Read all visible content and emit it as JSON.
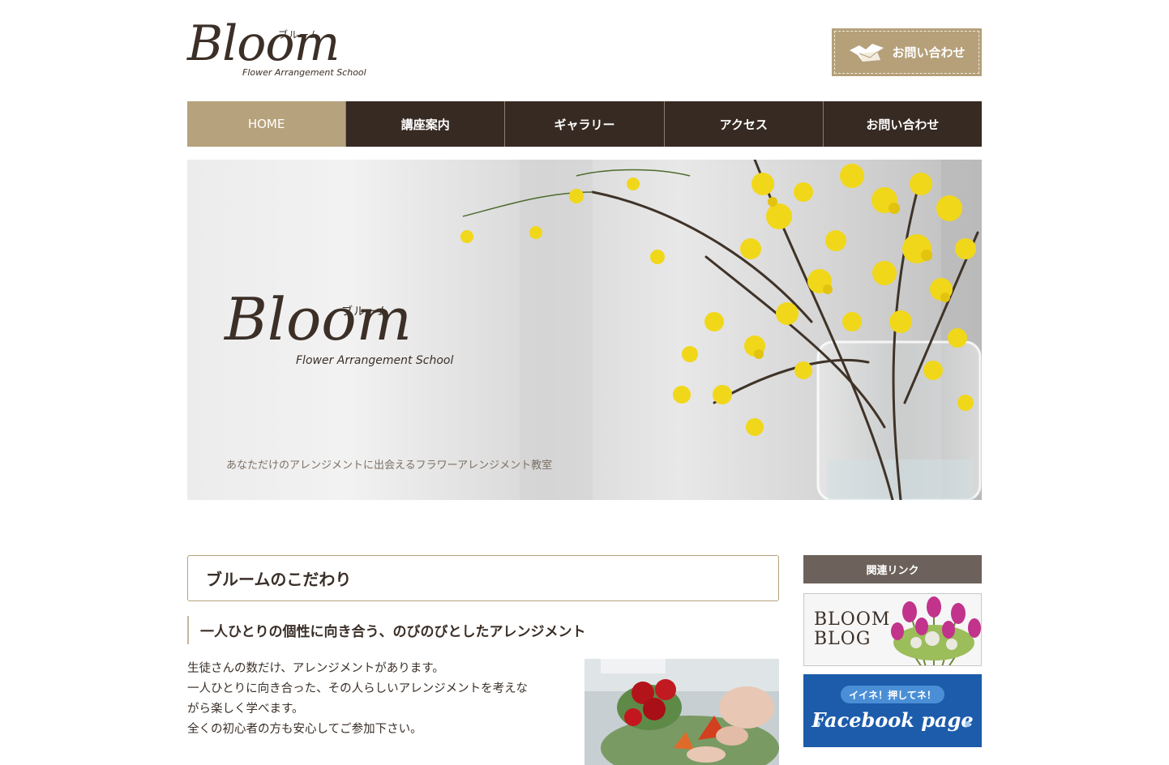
{
  "header": {
    "logo_script": "Bloom",
    "logo_kana": "ブルーム",
    "logo_sub": "Flower Arrangement School",
    "contact_button": "お問い合わせ",
    "contact_icon": "envelope-bird-icon"
  },
  "nav": {
    "items": [
      {
        "label": "HOME",
        "active": true
      },
      {
        "label": "講座案内"
      },
      {
        "label": "ギャラリー"
      },
      {
        "label": "アクセス"
      },
      {
        "label": "お問い合わせ"
      }
    ]
  },
  "hero": {
    "logo_script": "Bloom",
    "logo_kana": "ブルーム",
    "logo_sub": "Flower Arrangement School",
    "tagline": "あなただけのアレンジメントに出会えるフラワーアレンジメント教室"
  },
  "main": {
    "section_title": "ブルームのこだわり",
    "sub_heading": "一人ひとりの個性に向き合う、のびのびとしたアレンジメント",
    "body_lines": [
      "生徒さんの数だけ、アレンジメントがあります。",
      "一人ひとりに向き合った、その人らしいアレンジメントを考えな",
      "がら楽しく学べます。",
      "全くの初心者の方も安心してご参加下さい。"
    ]
  },
  "sidebar": {
    "heading": "関連リンク",
    "blog_banner": {
      "line1": "BLOOM",
      "line2": "BLOG"
    },
    "facebook_banner": {
      "pill": "イイネ！押してネ！",
      "text": "Facebook page"
    }
  },
  "colors": {
    "accent_gold": "#b6a27c",
    "nav_dark": "#372a22",
    "sidebar_head": "#6d625b",
    "facebook_blue": "#1c5cab"
  }
}
